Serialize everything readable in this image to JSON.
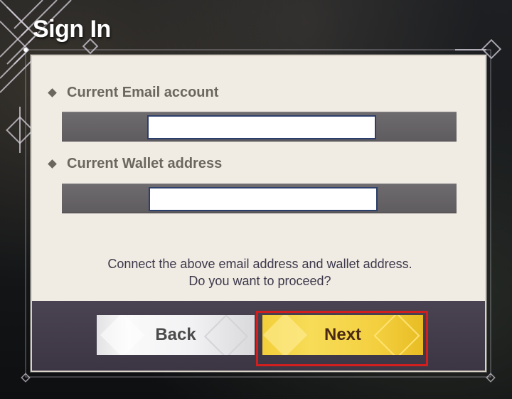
{
  "header": {
    "title": "Sign In"
  },
  "form": {
    "email": {
      "label": "Current Email account",
      "value": "",
      "placeholder": ""
    },
    "wallet": {
      "label": "Current Wallet address",
      "value": "",
      "placeholder": ""
    }
  },
  "message": {
    "line1": "Connect the above email address and wallet address.",
    "line2": "Do you want to proceed?"
  },
  "buttons": {
    "back_label": "Back",
    "next_label": "Next"
  },
  "colors": {
    "panel": "#f0ebe3",
    "footer": "#433c4a",
    "next_button": "#f4d040",
    "back_button": "#f2f2f4",
    "highlight": "#d11f1f"
  },
  "icons": {
    "bullet": "diamond-bullet-icon",
    "corner": "diamond-ornament-icon"
  }
}
